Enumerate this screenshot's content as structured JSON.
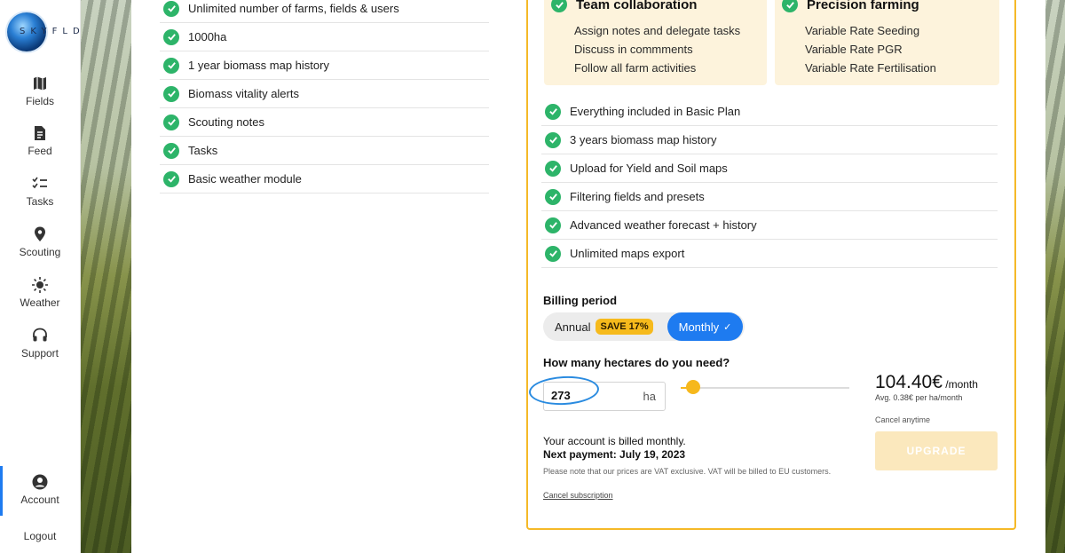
{
  "logo": {
    "text": "SKYFLD"
  },
  "sidebar": {
    "items": [
      {
        "label": "Fields",
        "icon": "map-icon"
      },
      {
        "label": "Feed",
        "icon": "document-icon"
      },
      {
        "label": "Tasks",
        "icon": "checklist-icon"
      },
      {
        "label": "Scouting",
        "icon": "location-pin-icon"
      },
      {
        "label": "Weather",
        "icon": "sun-icon"
      },
      {
        "label": "Support",
        "icon": "headset-icon"
      }
    ],
    "account": {
      "label": "Account",
      "icon": "user-circle-icon"
    },
    "logout": "Logout"
  },
  "basic_plan": {
    "features": [
      "Unlimited number of farms, fields & users",
      "1000ha",
      "1 year biomass map history",
      "Biomass vitality alerts",
      "Scouting notes",
      "Tasks",
      "Basic weather module"
    ]
  },
  "premium_plan": {
    "team": {
      "title": "Team collaboration",
      "lines": [
        "Assign notes and delegate tasks",
        "Discuss in commments",
        "Follow all farm activities"
      ]
    },
    "precision": {
      "title": "Precision farming",
      "lines": [
        "Variable Rate Seeding",
        "Variable Rate PGR",
        "Variable Rate Fertilisation"
      ]
    },
    "features": [
      "Everything included in Basic Plan",
      "3 years biomass map history",
      "Upload for Yield and Soil maps",
      "Filtering fields and presets",
      "Advanced weather forecast + history",
      "Unlimited maps export"
    ],
    "billing": {
      "title": "Billing period",
      "annual_label": "Annual",
      "save_badge": "SAVE 17%",
      "monthly_label": "Monthly",
      "selected": "Monthly"
    },
    "hectares": {
      "title": "How many hectares do you need?",
      "value": "273",
      "unit": "ha",
      "slider_fraction": 0.04
    },
    "price": {
      "amount": "104.40€",
      "per": " /month",
      "avg": "Avg. 0.38€ per ha/month",
      "cancel_anytime": "Cancel anytime",
      "upgrade_label": "UPGRADE"
    },
    "billing_note": {
      "line1": "Your account is billed monthly.",
      "line2": "Next payment: July 19, 2023",
      "vat": "Please note that our prices are VAT exclusive. VAT will be billed to EU customers.",
      "cancel_link": "Cancel subscription"
    }
  },
  "colors": {
    "accent_blue": "#1e7bf0",
    "accent_yellow": "#f5b928",
    "check_green": "#2db469"
  }
}
